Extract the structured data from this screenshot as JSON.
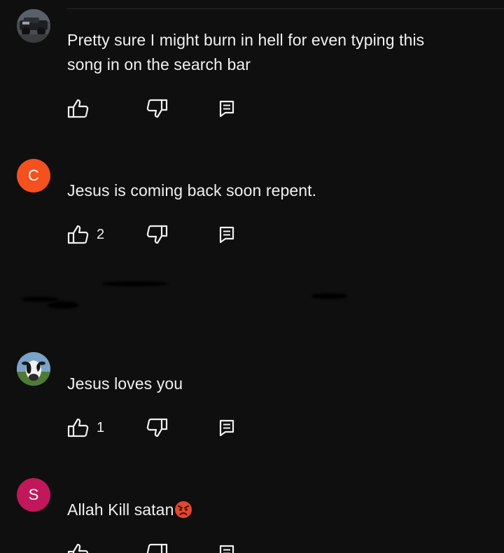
{
  "comments": [
    {
      "avatar_kind": "photo-truck",
      "text": "Pretty sure I might burn in hell for even typing this song in on the search bar",
      "likes": ""
    },
    {
      "avatar_kind": "letter",
      "avatar_letter": "C",
      "avatar_color": "#f4511e",
      "text": "Jesus is coming back soon repent.",
      "likes": "2"
    },
    {
      "avatar_kind": "photo-cow",
      "text": "Jesus loves you",
      "likes": "1"
    },
    {
      "avatar_kind": "letter",
      "avatar_letter": "S",
      "avatar_color": "#c2185b",
      "text": "Allah Kill satan",
      "emoji": "angry-face",
      "likes": ""
    }
  ],
  "icons": {
    "like": "thumbs-up-icon",
    "dislike": "thumbs-down-icon",
    "reply": "reply-icon"
  },
  "colors": {
    "background": "#0f0f0f",
    "text": "#f1f1f1"
  }
}
